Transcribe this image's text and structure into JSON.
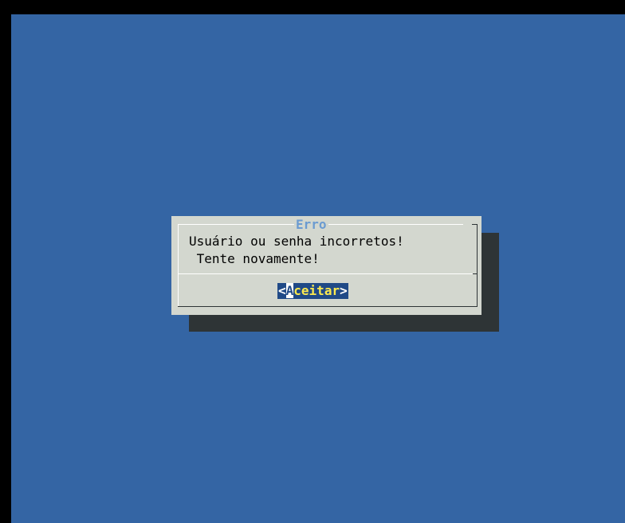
{
  "dialog": {
    "title": "Erro",
    "message": "Usuário ou senha incorretos!\n Tente novamente!",
    "button": {
      "left_bracket": "<",
      "hotkey": "A",
      "label_rest": "ceitar",
      "right_bracket": ">"
    }
  },
  "colors": {
    "background": "#3465a4",
    "dialog": "#d3d7cf",
    "shadow": "#2e3436",
    "title": "#6b9bd1",
    "button_bg": "#204a87",
    "button_text": "#fce94f"
  }
}
